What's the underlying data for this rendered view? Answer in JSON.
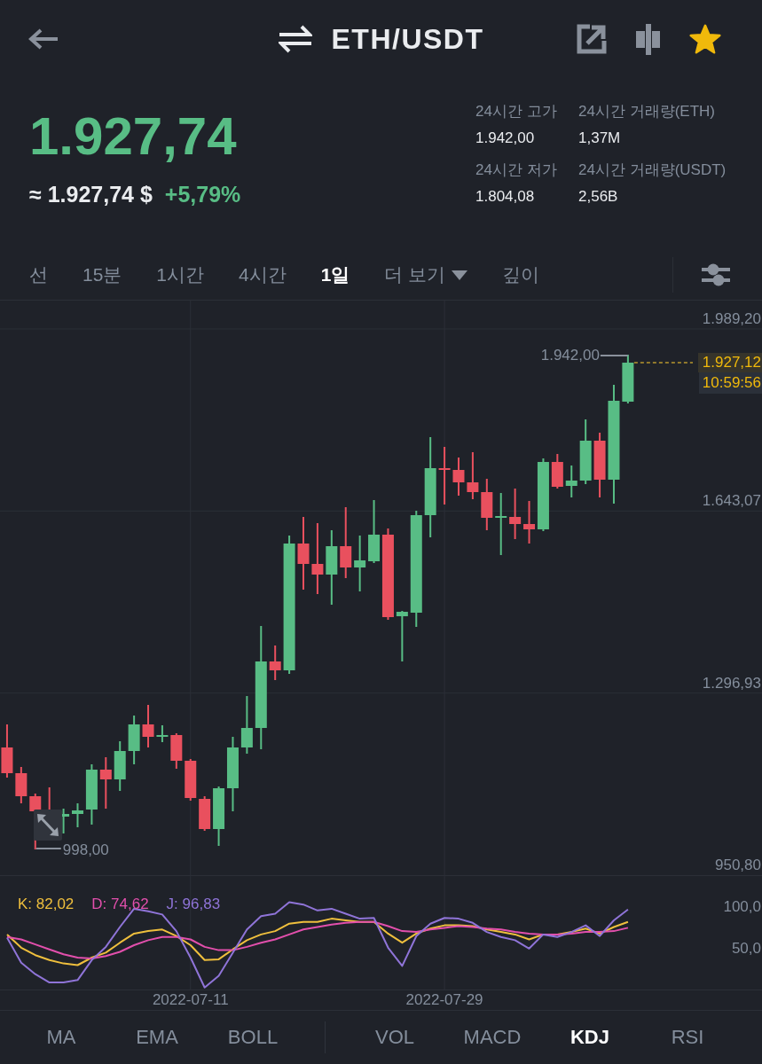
{
  "header": {
    "title": "ETH/USDT",
    "favorite": true
  },
  "ticker": {
    "last_price": "1.927,74",
    "fiat_price": "≈ 1.927,74 $",
    "change": "+5,79%",
    "stats": [
      {
        "label": "24시간 고가",
        "value": "1.942,00"
      },
      {
        "label": "24시간 거래량(ETH)",
        "value": "1,37M"
      },
      {
        "label": "24시간 저가",
        "value": "1.804,08"
      },
      {
        "label": "24시간 거래량(USDT)",
        "value": "2,56B"
      }
    ]
  },
  "interval_tabs": [
    {
      "label": "선",
      "kind": "tab",
      "selected": false
    },
    {
      "label": "15분",
      "kind": "tab",
      "selected": false
    },
    {
      "label": "1시간",
      "kind": "tab",
      "selected": false
    },
    {
      "label": "4시간",
      "kind": "tab",
      "selected": false
    },
    {
      "label": "1일",
      "kind": "tab",
      "selected": true
    },
    {
      "label": "더 보기",
      "kind": "menu",
      "selected": false
    },
    {
      "label": "깊이",
      "kind": "tab",
      "selected": false
    }
  ],
  "price_chart": {
    "axis_labels": [
      "1.989,20",
      "1.643,07",
      "1.296,93",
      "950,80"
    ],
    "high_label": "1.942,00",
    "low_label": "998,00",
    "last_price": "1.927,12",
    "countdown": "10:59:56"
  },
  "indicator_chart": {
    "chart_data": {
      "type": "line",
      "categories": [
        null,
        null,
        null,
        null,
        null,
        null,
        null,
        null,
        null,
        null,
        null,
        null,
        null,
        "2022-07-11",
        null,
        null,
        null,
        null,
        null,
        null,
        null,
        null,
        null,
        null,
        null,
        null,
        null,
        null,
        null,
        null,
        null,
        "2022-07-29",
        null,
        null,
        null,
        null,
        null,
        null,
        null,
        null,
        null,
        null,
        null,
        null,
        null,
        null,
        null,
        null,
        null,
        null,
        null,
        null,
        null,
        null
      ],
      "ylim": [
        0,
        138
      ],
      "yticks": [
        {
          "value": 100,
          "label": "100,0"
        },
        {
          "value": 50,
          "label": "50,0"
        }
      ],
      "series": [
        {
          "name": "K: 82,02",
          "color": "#efbf3d",
          "values": [
            67,
            51,
            42,
            36,
            32,
            30,
            39,
            45,
            57,
            68,
            71,
            73,
            65,
            54,
            36,
            37,
            49,
            60,
            67,
            71,
            80,
            82,
            82,
            86,
            84,
            82,
            82,
            68,
            57,
            68,
            74,
            78,
            78,
            77,
            73,
            70,
            67,
            61,
            67,
            67,
            70,
            74,
            68,
            76,
            82,
            null,
            null,
            null,
            null,
            null,
            null,
            null,
            null,
            null
          ]
        },
        {
          "name": "D: 74,62",
          "color": "#e24fac",
          "values": [
            64,
            61,
            55,
            49,
            43,
            39,
            38,
            41,
            46,
            54,
            60,
            64,
            64,
            61,
            52,
            48,
            48,
            52,
            57,
            61,
            67,
            73,
            76,
            79,
            81,
            82,
            82,
            77,
            71,
            70,
            73,
            75,
            77,
            76,
            74,
            73,
            70,
            68,
            67,
            67,
            68,
            70,
            70,
            71,
            75,
            null,
            null,
            null,
            null,
            null,
            null,
            null,
            null,
            null
          ]
        },
        {
          "name": "J: 96,83",
          "color": "#8f74d8",
          "values": [
            63,
            33,
            19,
            9,
            9,
            12,
            36,
            52,
            76,
            98,
            95,
            91,
            71,
            39,
            3,
            17,
            45,
            73,
            89,
            92,
            106,
            103,
            96,
            98,
            92,
            86,
            87,
            51,
            29,
            65,
            80,
            87,
            86,
            81,
            70,
            64,
            60,
            50,
            67,
            64,
            70,
            78,
            65,
            84,
            97,
            null,
            null,
            null,
            null,
            null,
            null,
            null,
            null,
            null
          ]
        }
      ]
    }
  },
  "indicator_tabs": {
    "main": [
      {
        "label": "MA",
        "selected": false
      },
      {
        "label": "EMA",
        "selected": false
      },
      {
        "label": "BOLL",
        "selected": false
      }
    ],
    "sub": [
      {
        "label": "VOL",
        "selected": false
      },
      {
        "label": "MACD",
        "selected": false
      },
      {
        "label": "KDJ",
        "selected": true
      },
      {
        "label": "RSI",
        "selected": false
      }
    ]
  }
}
